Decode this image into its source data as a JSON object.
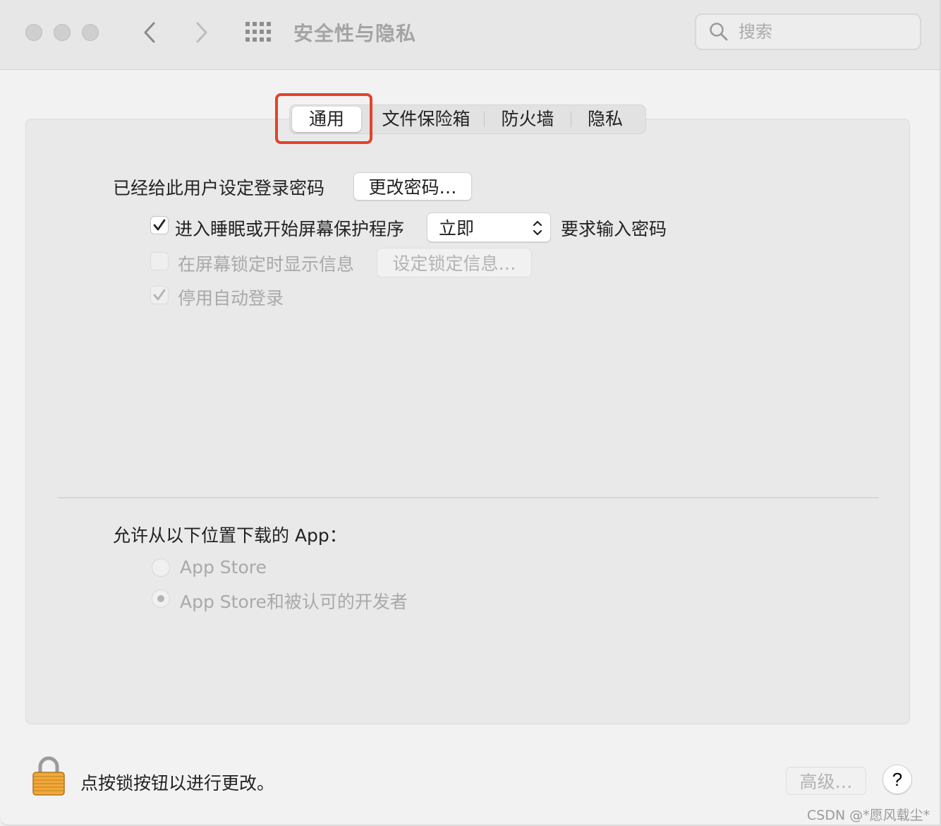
{
  "window": {
    "title": "安全性与隐私",
    "search_placeholder": "搜索"
  },
  "tabs": [
    {
      "label": "通用",
      "active": true
    },
    {
      "label": "文件保险箱",
      "active": false
    },
    {
      "label": "防火墙",
      "active": false
    },
    {
      "label": "隐私",
      "active": false
    }
  ],
  "general": {
    "password_set_label": "已经给此用户设定登录密码",
    "change_password_button": "更改密码…",
    "require_password": {
      "checked": true,
      "label_before": "进入睡眠或开始屏幕保护程序",
      "select_value": "立即",
      "label_after": "要求输入密码"
    },
    "show_message": {
      "checked": false,
      "label": "在屏幕锁定时显示信息",
      "button": "设定锁定信息…"
    },
    "disable_autologin": {
      "checked": true,
      "label": "停用自动登录"
    }
  },
  "downloads": {
    "heading": "允许从以下位置下载的 App：",
    "options": [
      {
        "label": "App Store",
        "selected": false
      },
      {
        "label": "App Store和被认可的开发者",
        "selected": true
      }
    ]
  },
  "footer": {
    "lock_text": "点按锁按钮以进行更改。",
    "advanced_button": "高级…",
    "help_button": "?"
  },
  "watermark": "CSDN @*愿风载尘*",
  "colors": {
    "highlight": "#e4412b",
    "disabled_text": "#a9a9a9"
  }
}
